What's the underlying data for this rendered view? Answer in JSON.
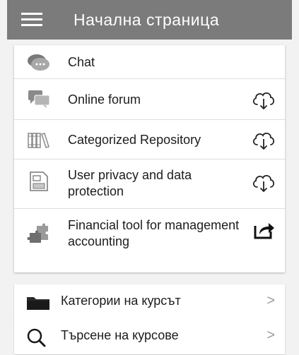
{
  "appbar": {
    "title": "Начална страница",
    "menu_icon": "hamburger-menu-icon"
  },
  "modules": [
    {
      "label": "Chat",
      "icon": "chat-bubble-icon",
      "action_icon": ""
    },
    {
      "label": "Online forum",
      "icon": "forum-icon",
      "action_icon": "cloud-download-icon"
    },
    {
      "label": "Categorized Repository",
      "icon": "books-icon",
      "action_icon": "cloud-download-icon"
    },
    {
      "label": "User privacy and data protection",
      "icon": "document-icon",
      "action_icon": "cloud-download-icon"
    },
    {
      "label": "Financial tool for management accounting",
      "icon": "puzzle-icon",
      "action_icon": "share-external-icon"
    }
  ],
  "nav": {
    "categories": {
      "label": "Категории на курсът",
      "icon": "folder-icon",
      "chevron": ">"
    },
    "search": {
      "label": "Търсене на курсове",
      "icon": "search-icon",
      "chevron": ">"
    }
  },
  "colors": {
    "appbar": "#7b7b7b",
    "background": "#f2f2f2",
    "card": "#ffffff",
    "icon_gray": "#8a8a8a"
  }
}
